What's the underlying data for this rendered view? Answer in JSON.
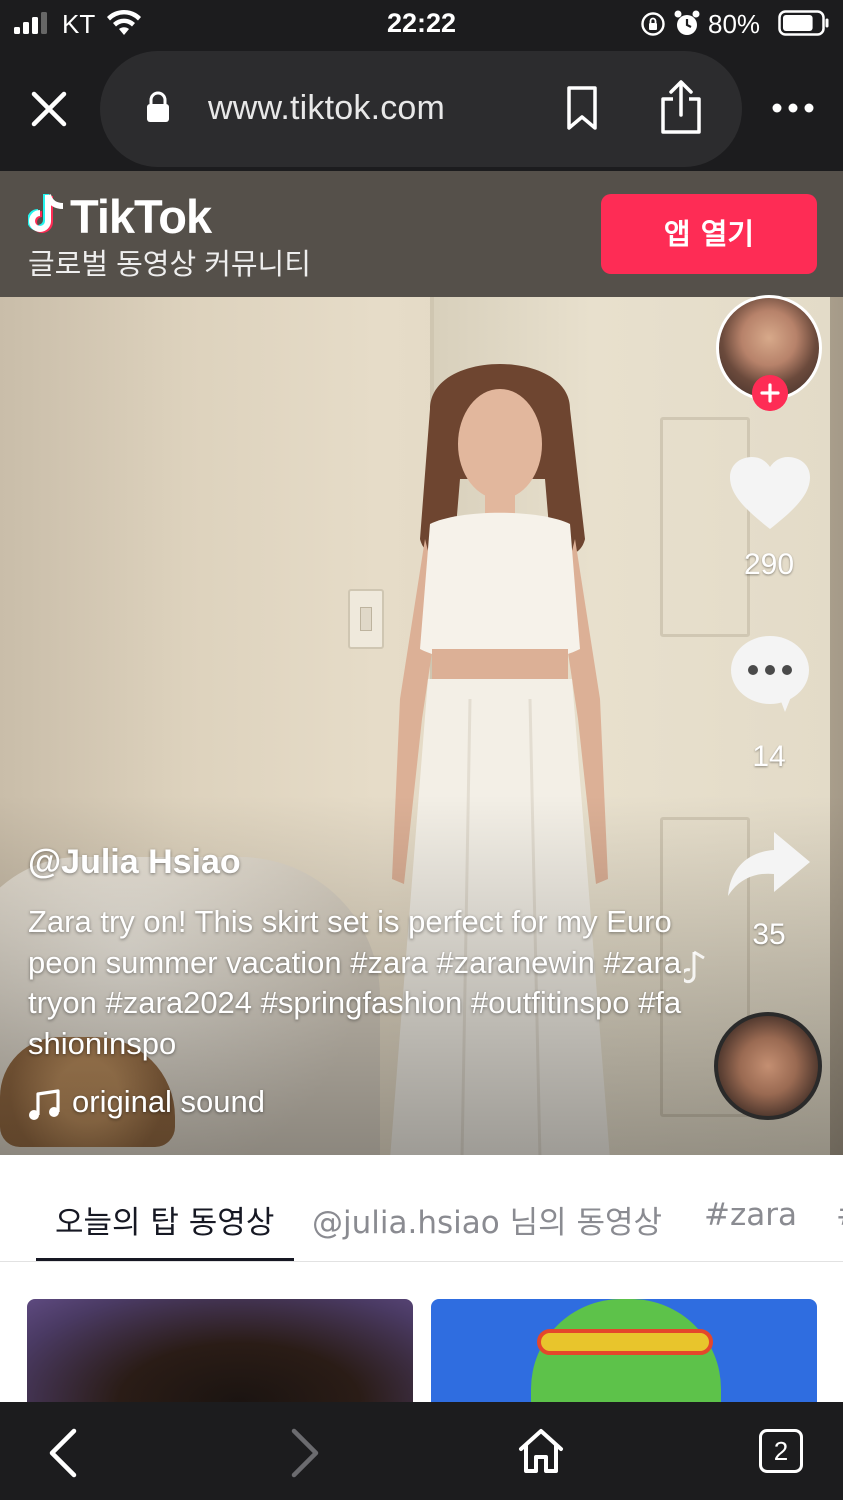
{
  "status_bar": {
    "carrier": "KT",
    "time": "22:22",
    "battery_percent": "80%",
    "battery_level": 0.8
  },
  "browser": {
    "url": "www.tiktok.com"
  },
  "banner": {
    "logo_text": "TikTok",
    "subtitle": "글로벌 동영상 커뮤니티",
    "open_app_label": "앱 열기",
    "accent_color": "#fe2c55"
  },
  "video": {
    "username": "@Julia Hsiao",
    "caption": "Zara try on! This skirt set is perfect for my Europeon summer vacation #zara #zaranewin #zaratryon #zara2024 #springfashion #outfitinspo #fashioninspo",
    "sound": "original sound",
    "likes": "290",
    "comments": "14",
    "shares": "35"
  },
  "tabs": {
    "items": [
      {
        "label": "오늘의 탑 동영상",
        "active": true
      },
      {
        "label": "@julia.hsiao 님의 동영상",
        "active": false
      },
      {
        "label": "#zara",
        "active": false
      },
      {
        "label": "#",
        "active": false
      }
    ]
  },
  "toolbar": {
    "tab_count": "2"
  }
}
